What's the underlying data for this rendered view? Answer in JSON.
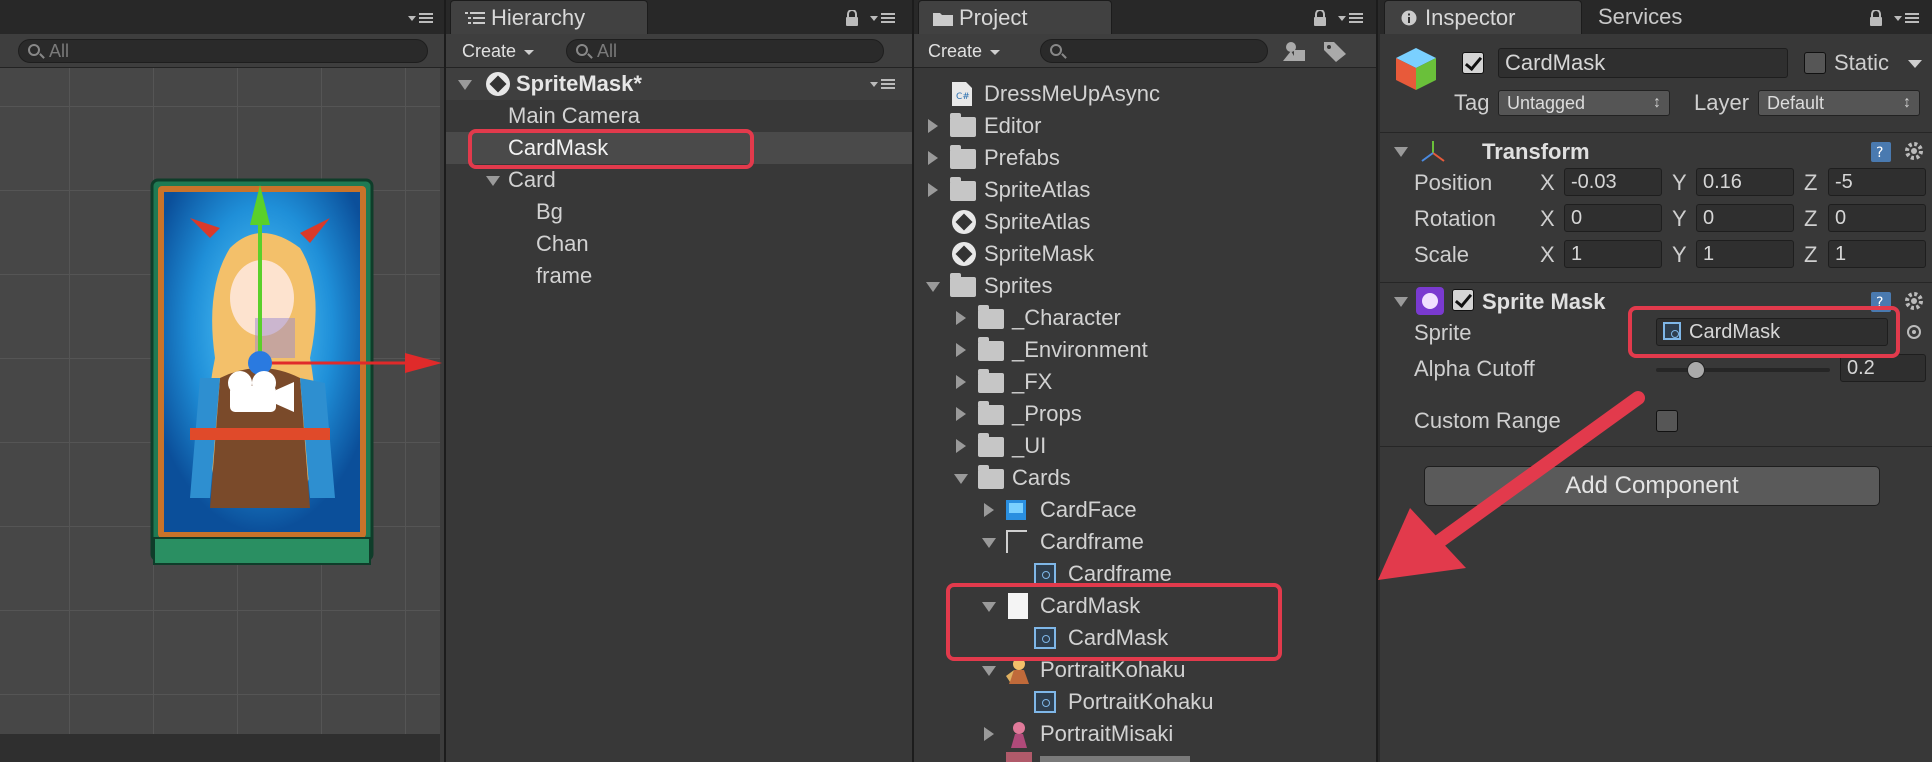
{
  "colors": {
    "highlight": "#e23a4c",
    "panel": "#383838",
    "selection": "#4a4a4a"
  },
  "scene": {
    "search_placeholder": "All"
  },
  "hierarchy": {
    "tab": "Hierarchy",
    "create": "Create",
    "search_placeholder": "All",
    "scene_name": "SpriteMask*",
    "items": [
      "Main Camera",
      "CardMask",
      "Card",
      "Bg",
      "Chan",
      "frame"
    ]
  },
  "project": {
    "tab": "Project",
    "create": "Create",
    "items": [
      "DressMeUpAsync",
      "Editor",
      "Prefabs",
      "SpriteAtlas",
      "SpriteAtlas",
      "SpriteMask",
      "Sprites",
      "_Character",
      "_Environment",
      "_FX",
      "_Props",
      "_UI",
      "Cards",
      "CardFace",
      "Cardframe",
      "Cardframe",
      "CardMask",
      "CardMask",
      "PortraitKohaku",
      "PortraitKohaku",
      "PortraitMisaki"
    ]
  },
  "inspector": {
    "tab": "Inspector",
    "tab2": "Services",
    "name": "CardMask",
    "static_label": "Static",
    "tag_label": "Tag",
    "tag_value": "Untagged",
    "layer_label": "Layer",
    "layer_value": "Default",
    "transform": {
      "title": "Transform",
      "position_label": "Position",
      "rotation_label": "Rotation",
      "scale_label": "Scale",
      "x": "X",
      "y": "Y",
      "z": "Z",
      "position": [
        "-0.03",
        "0.16",
        "-5"
      ],
      "rotation": [
        "0",
        "0",
        "0"
      ],
      "scale": [
        "1",
        "1",
        "1"
      ]
    },
    "sprite_mask": {
      "title": "Sprite Mask",
      "sprite_label": "Sprite",
      "sprite_value": "CardMask",
      "alpha_label": "Alpha Cutoff",
      "alpha_value": "0.2",
      "alpha_fraction": 0.2,
      "custom_range_label": "Custom Range"
    },
    "add_component": "Add Component"
  }
}
